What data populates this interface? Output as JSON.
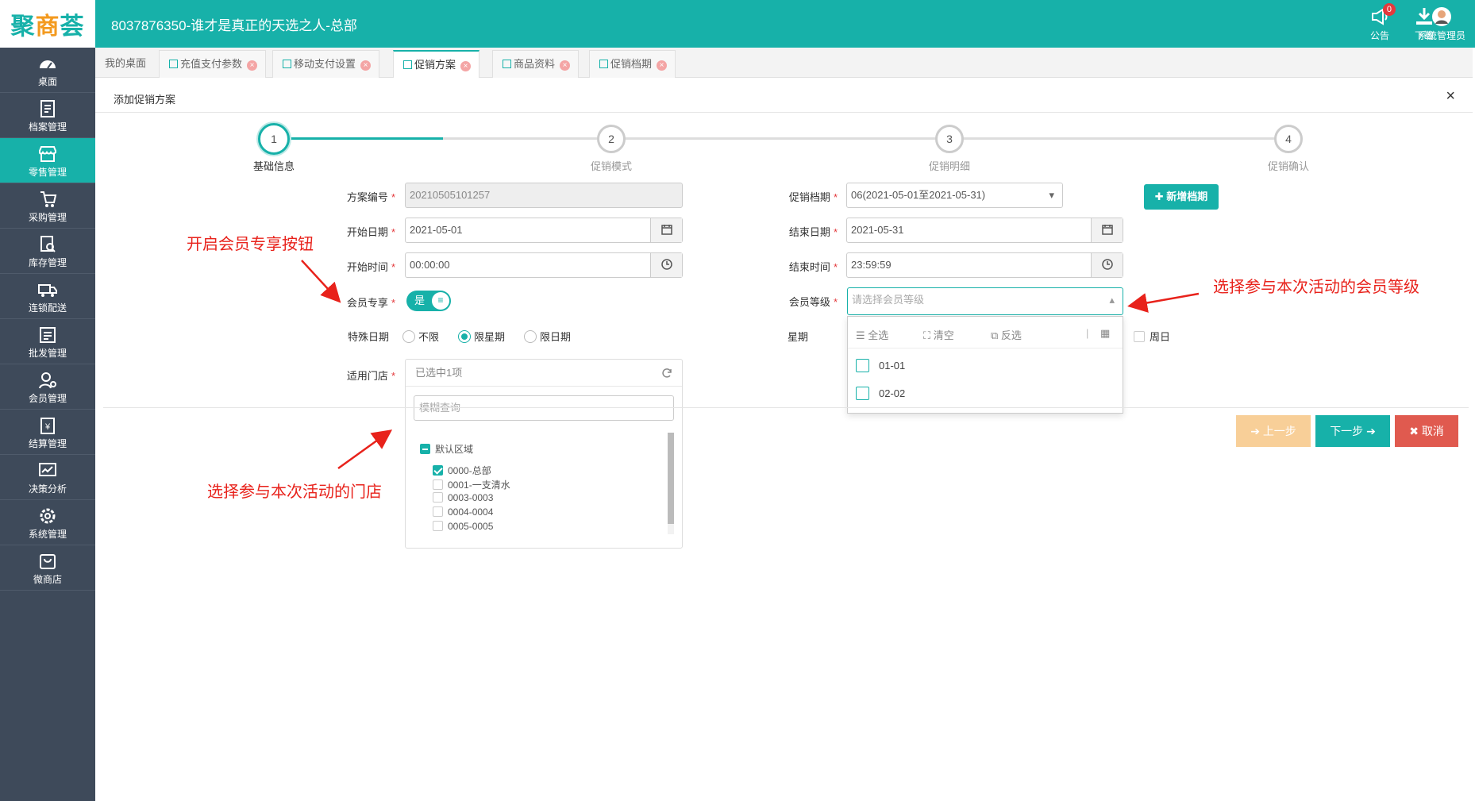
{
  "brand": {
    "logo_text_a": "聚",
    "logo_text_b": "商",
    "logo_text_c": "荟",
    "accent": "#17b1a9"
  },
  "header": {
    "title": "8037876350-谁才是真正的天选之人-总部",
    "notice_label": "公告",
    "notice_count": "0",
    "download_label": "下载",
    "user_label": "系统管理员"
  },
  "sidebar": {
    "items": [
      {
        "label": "桌面",
        "icon": "dashboard-icon"
      },
      {
        "label": "档案管理",
        "icon": "archive-icon"
      },
      {
        "label": "零售管理",
        "icon": "store-icon"
      },
      {
        "label": "采购管理",
        "icon": "cart-icon"
      },
      {
        "label": "库存管理",
        "icon": "inventory-icon"
      },
      {
        "label": "连锁配送",
        "icon": "truck-icon"
      },
      {
        "label": "批发管理",
        "icon": "wholesale-icon"
      },
      {
        "label": "会员管理",
        "icon": "member-icon"
      },
      {
        "label": "结算管理",
        "icon": "settlement-icon"
      },
      {
        "label": "决策分析",
        "icon": "chart-icon"
      },
      {
        "label": "系统管理",
        "icon": "gear-icon"
      },
      {
        "label": "微商店",
        "icon": "shop-bag-icon"
      }
    ]
  },
  "tabs": [
    {
      "label": "我的桌面"
    },
    {
      "label": "充值支付参数"
    },
    {
      "label": "移动支付设置"
    },
    {
      "label": "促销方案"
    },
    {
      "label": "商品资料"
    },
    {
      "label": "促销档期"
    }
  ],
  "panel": {
    "title": "添加促销方案",
    "close": "×"
  },
  "steps": [
    {
      "num": "1",
      "label": "基础信息"
    },
    {
      "num": "2",
      "label": "促销模式"
    },
    {
      "num": "3",
      "label": "促销明细"
    },
    {
      "num": "4",
      "label": "促销确认"
    }
  ],
  "form": {
    "plan_no_label": "方案编号",
    "plan_no_value": "20210505101257",
    "start_date_label": "开始日期",
    "start_date_value": "2021-05-01",
    "start_time_label": "开始时间",
    "start_time_value": "00:00:00",
    "member_only_label": "会员专享",
    "member_only_value": "是",
    "special_date_label": "特殊日期",
    "special_options": [
      "不限",
      "限星期",
      "限日期"
    ],
    "stores_label": "适用门店",
    "stores_selected": "已选中1项",
    "stores_search_placeholder": "模糊查询",
    "store_root": "默认区域",
    "stores": [
      "0000-总部",
      "0001-一支清水",
      "0003-0003",
      "0004-0004",
      "0005-0005"
    ],
    "schedule_label": "促销档期",
    "schedule_value": "06(2021-05-01至2021-05-31)",
    "new_schedule_button": "新增档期",
    "end_date_label": "结束日期",
    "end_date_value": "2021-05-31",
    "end_time_label": "结束时间",
    "end_time_value": "23:59:59",
    "member_level_label": "会员等级",
    "member_level_placeholder": "请选择会员等级",
    "week_label": "星期",
    "sunday_label": "周日",
    "required_mark": "*"
  },
  "dropdown": {
    "select_all": "全选",
    "clear": "清空",
    "invert": "反选",
    "options": [
      "01-01",
      "02-02"
    ]
  },
  "buttons": {
    "prev": "上一步",
    "next": "下一步",
    "cancel": "取消"
  },
  "annotations": {
    "member_toggle": "开启会员专享按钮",
    "member_level": "选择参与本次活动的会员等级",
    "stores": "选择参与本次活动的门店"
  },
  "colors": {
    "teal": "#17b1a9",
    "prev_btn": "#f8cf98",
    "cancel_btn": "#e05a4f",
    "annotation": "#e8221b"
  }
}
